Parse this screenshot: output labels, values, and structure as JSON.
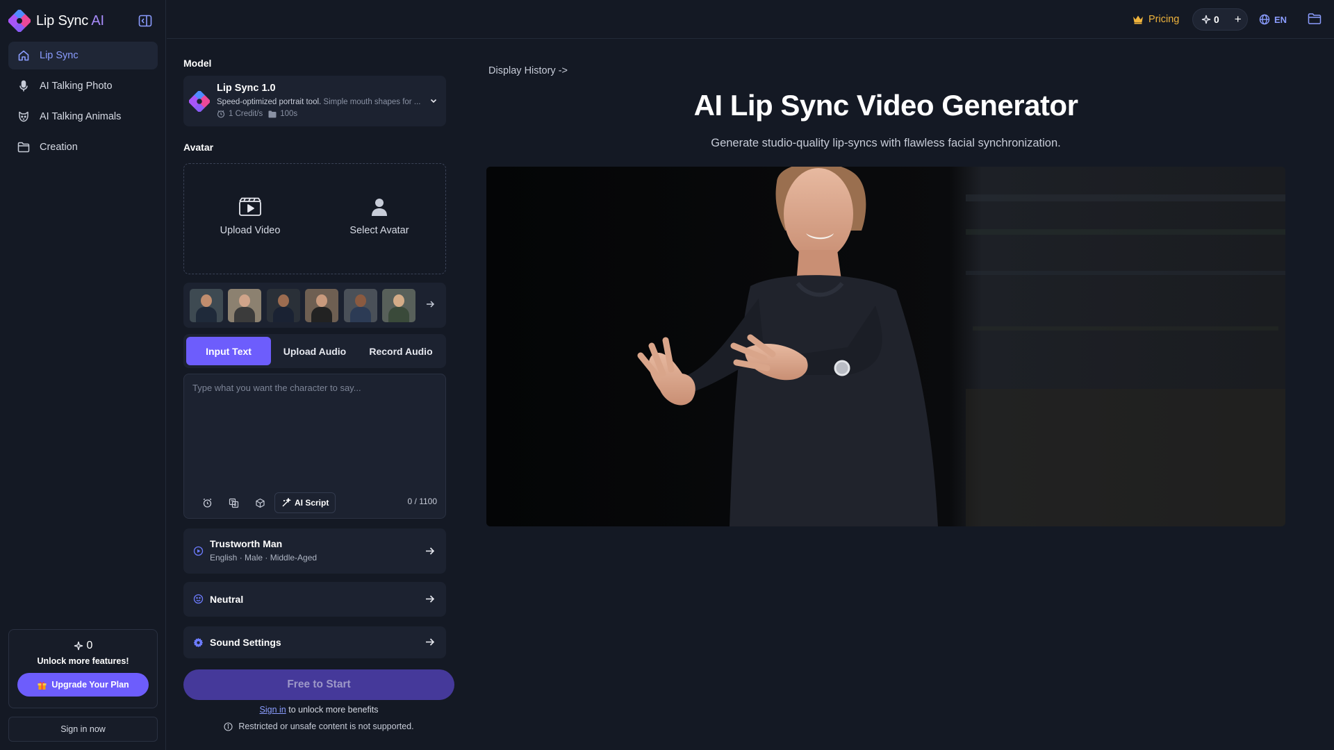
{
  "brand": {
    "name": "Lip Sync",
    "suffix": "AI"
  },
  "sidebar": {
    "items": [
      {
        "label": "Lip Sync",
        "icon": "home-icon",
        "active": true
      },
      {
        "label": "AI Talking Photo",
        "icon": "microphone-icon",
        "active": false
      },
      {
        "label": "AI Talking Animals",
        "icon": "cat-icon",
        "active": false
      },
      {
        "label": "Creation",
        "icon": "folder-icon",
        "active": false
      }
    ],
    "upgrade": {
      "credits": "0",
      "unlock_text": "Unlock more features!",
      "button_label": "Upgrade Your Plan"
    },
    "signin_label": "Sign in now"
  },
  "topbar": {
    "pricing_label": "Pricing",
    "credits": "0",
    "plus_label": "+",
    "language": "EN"
  },
  "panel": {
    "model_label": "Model",
    "model": {
      "name": "Lip Sync 1.0",
      "description": "Speed-optimized portrait tool.",
      "description_sub": "Simple mouth shapes for ...",
      "credits": "1 Credit/s",
      "duration": "100s"
    },
    "avatar_label": "Avatar",
    "avatar_options": {
      "upload_video": "Upload Video",
      "select_avatar": "Select Avatar"
    },
    "mode_tabs": [
      {
        "label": "Input Text",
        "active": true
      },
      {
        "label": "Upload Audio",
        "active": false
      },
      {
        "label": "Record Audio",
        "active": false
      }
    ],
    "text_input": {
      "placeholder": "Type what you want the character to say...",
      "value": "",
      "ai_script_label": "AI Script",
      "char_count": "0 / 1100"
    },
    "voice": {
      "name": "Trustworth Man",
      "details": "English · Male · Middle-Aged"
    },
    "emotion": {
      "label": "Neutral"
    },
    "sound_settings": {
      "label": "Sound Settings"
    },
    "start_button": "Free to Start",
    "signin_link": "Sign in",
    "signin_rest": " to unlock more benefits",
    "restricted_note": "Restricted or unsafe content is not supported."
  },
  "main": {
    "display_history": "Display History ->",
    "title": "AI Lip Sync Video Generator",
    "subtitle": "Generate studio-quality lip-syncs with flawless facial synchronization."
  },
  "colors": {
    "accent": "#6d5dfc",
    "accent_text": "#8b9dff",
    "pricing": "#f0b43c",
    "background": "#141924",
    "card": "#1c2230"
  }
}
